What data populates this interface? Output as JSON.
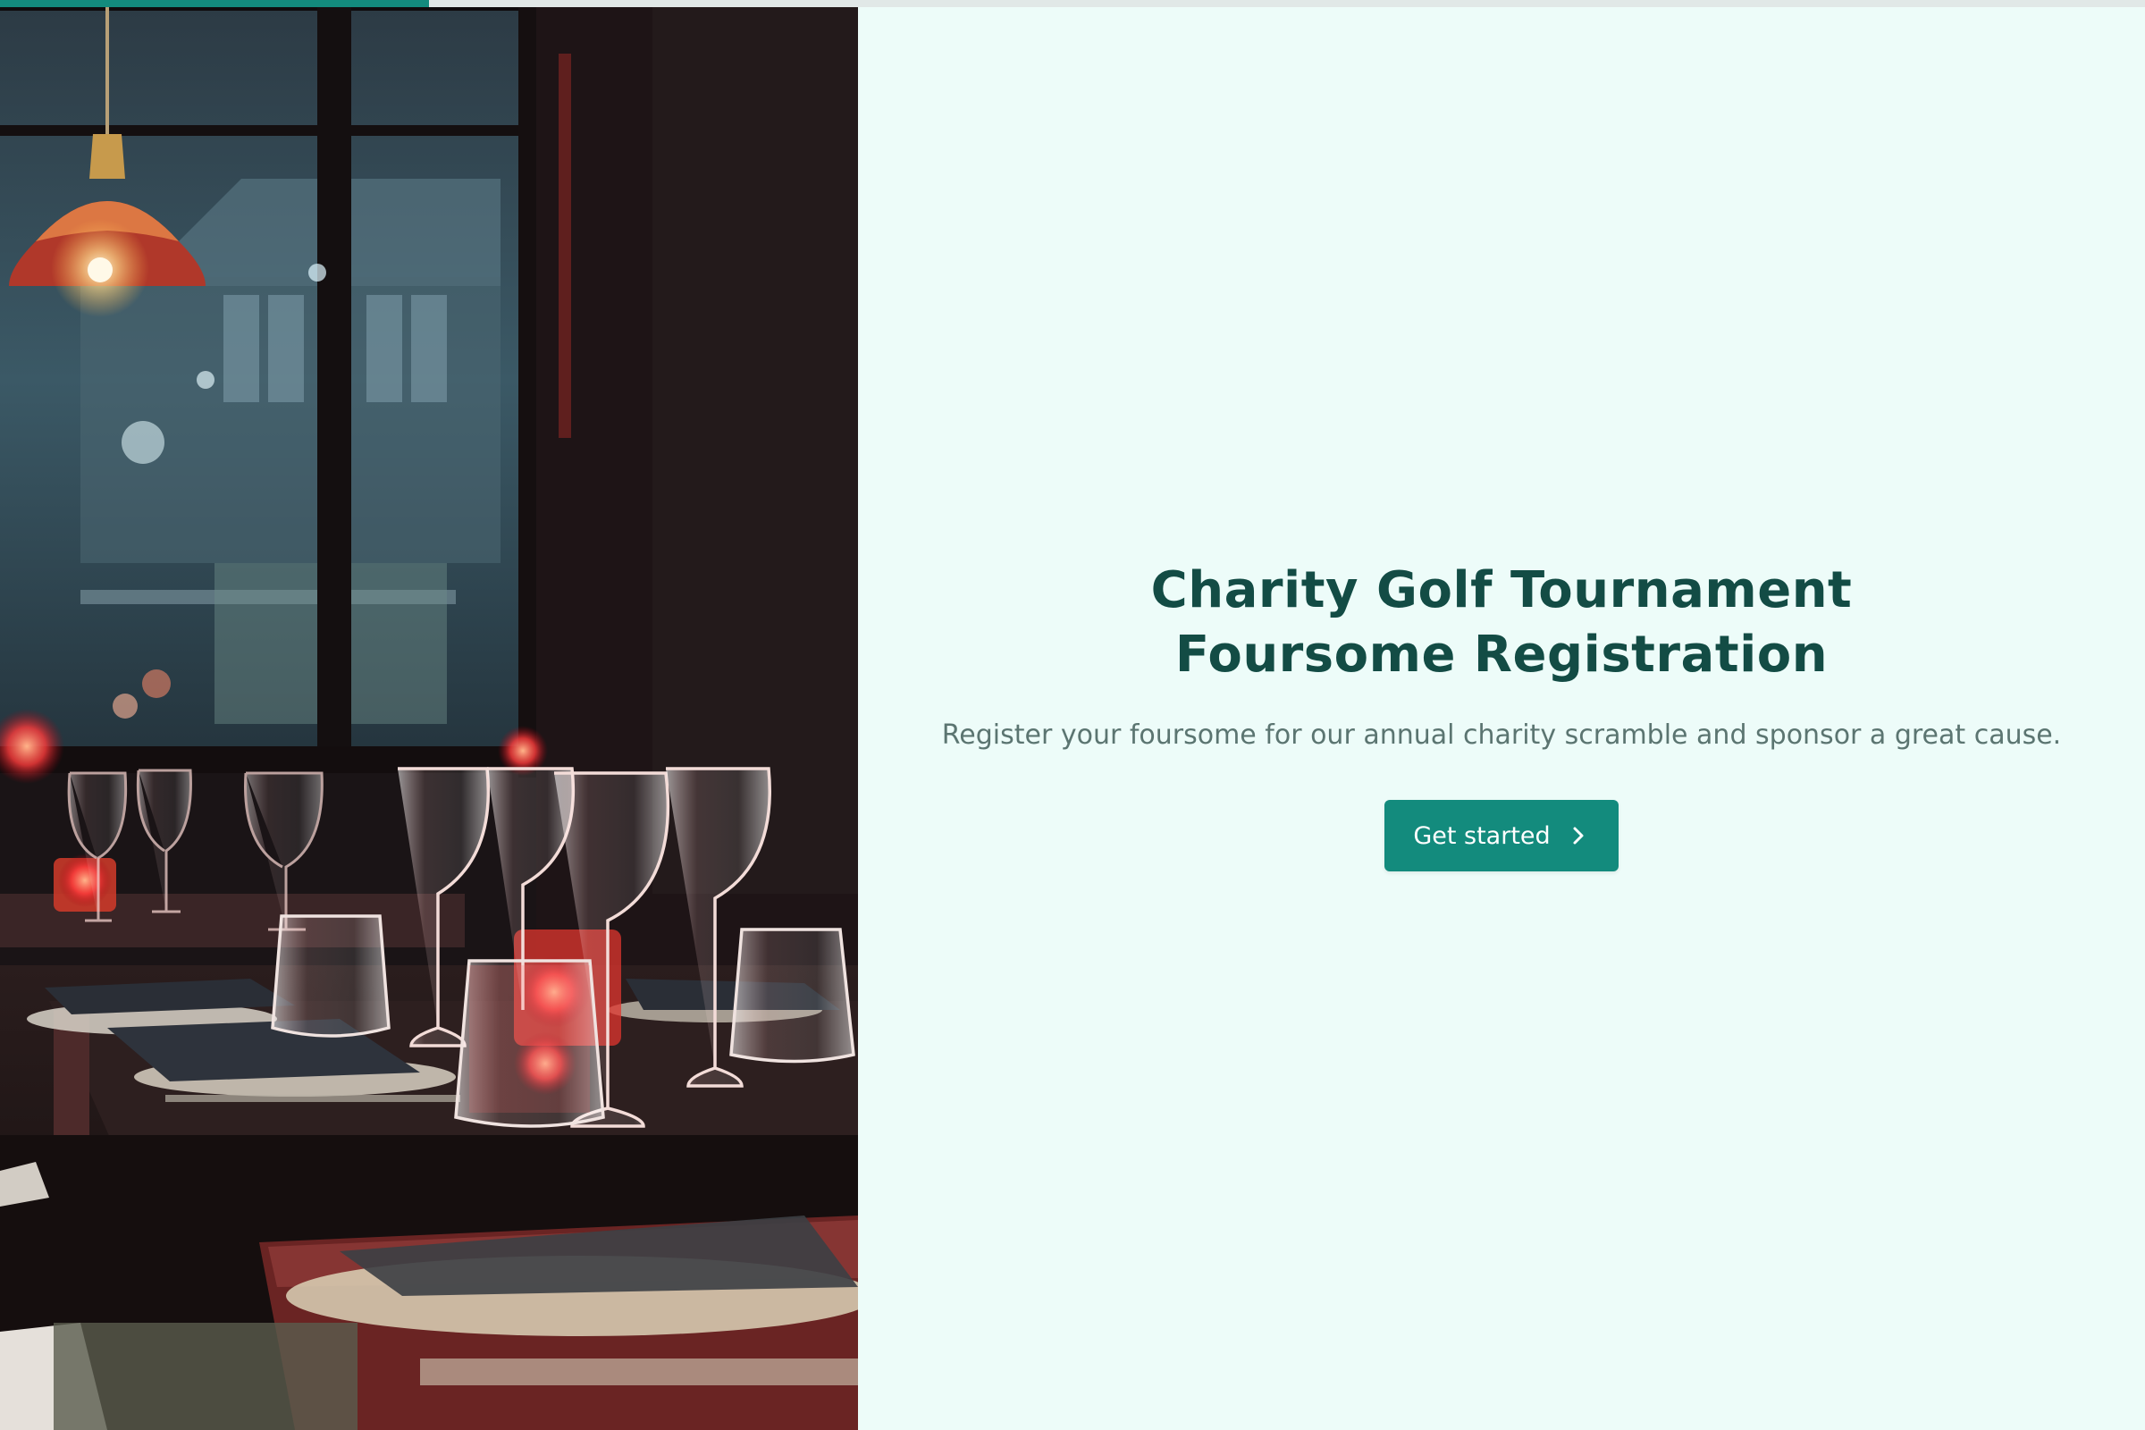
{
  "progress": {
    "value": 0.2
  },
  "hero": {
    "image_alt": "Restaurant dining tables set with wine glasses and candles",
    "title": "Charity Golf Tournament Foursome Registration",
    "subtitle": "Register your foursome for our annual charity scramble and sponsor a great cause.",
    "cta_label": "Get started",
    "cta_icon": "chevron-right-icon"
  },
  "colors": {
    "accent": "#138b7d",
    "title": "#134c45",
    "subtitle": "#5b7571",
    "background": "#edfcf9"
  }
}
